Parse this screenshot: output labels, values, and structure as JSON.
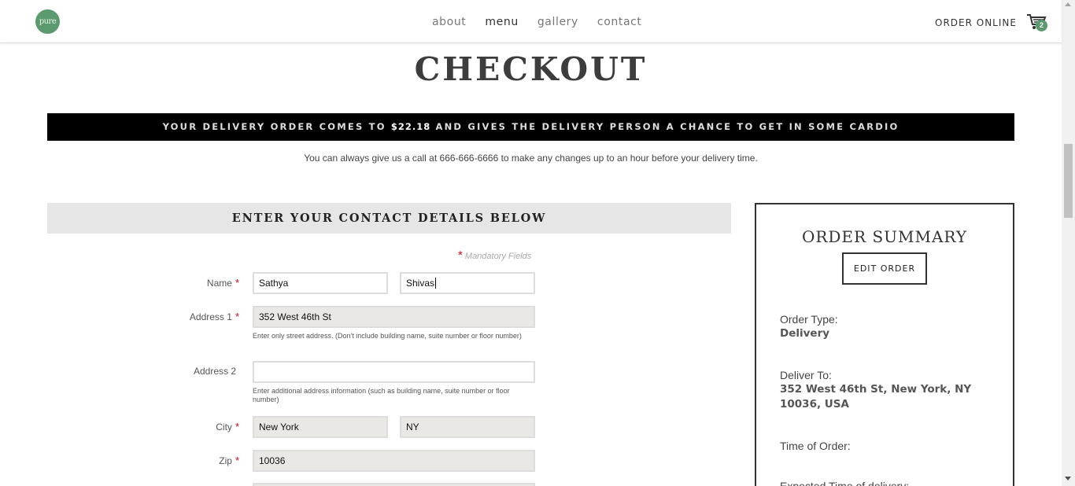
{
  "header": {
    "logo_text": "pure",
    "nav": [
      "about",
      "menu",
      "gallery",
      "contact"
    ],
    "active_nav": "menu",
    "order_online": "ORDER ONLINE",
    "cart_count": "2",
    "brand_color": "#5a9a6e"
  },
  "page": {
    "title": "CHECKOUT",
    "banner_pre": "YOUR DELIVERY ORDER COMES TO ",
    "banner_amount": "$22.18",
    "banner_post": " AND GIVES THE DELIVERY PERSON A CHANCE TO GET IN SOME CARDIO",
    "call_note": "You can always give us a call at 666-666-6666 to make any changes up to an hour before your delivery time."
  },
  "form": {
    "heading": "ENTER YOUR CONTACT DETAILS BELOW",
    "mandatory_note": "Mandatory Fields",
    "name_label": "Name",
    "first_name": "Sathya",
    "last_name": "Shivas",
    "address1_label": "Address 1",
    "address1": "352 West 46th St",
    "address1_hint": "Enter only street address. (Don't include building name, suite number or floor number)",
    "address2_label": "Address 2",
    "address2": "",
    "address2_hint": "Enter additional address information (such as building name, suite number or floor number)",
    "city_label": "City",
    "city": "New York",
    "state": "NY",
    "zip_label": "Zip",
    "zip": "10036"
  },
  "summary": {
    "title": "ORDER SUMMARY",
    "edit_label": "EDIT ORDER",
    "order_type_label": "Order Type:",
    "order_type": "Delivery",
    "deliver_to_label": "Deliver To:",
    "deliver_to": "352 West 46th St, New York, NY 10036, USA",
    "time_of_order_label": "Time of Order:",
    "expected_label": "Expected Time of delivery:"
  },
  "required_color": "#d0021b"
}
